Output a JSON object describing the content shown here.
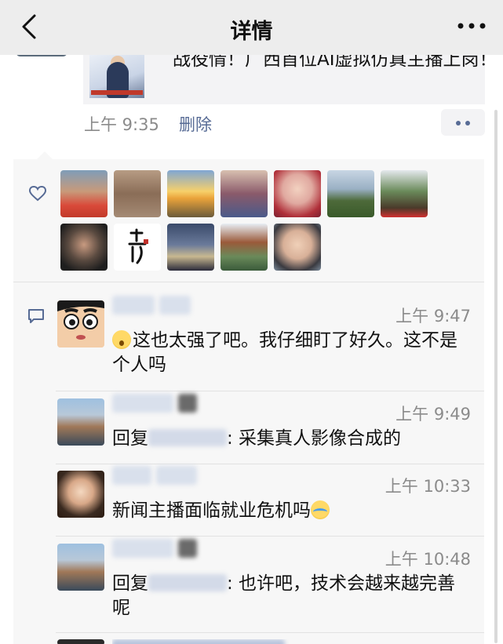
{
  "nav": {
    "title": "详情"
  },
  "post": {
    "share_text": "战役情！广西首位AI虚拟仿真主播上岗！",
    "time": "上午 9:35",
    "delete_label": "删除"
  },
  "likes": {
    "count": 12
  },
  "comments": [
    {
      "time": "上午 9:47",
      "text": "这也太强了吧。我仔细盯了好久。这不是个人吗",
      "emoji": "shocked-face-icon"
    },
    {
      "time": "上午 9:49",
      "reply_prefix": "回复",
      "text": ": 采集真人影像合成的"
    },
    {
      "time": "上午 10:33",
      "text": "新闻主播面临就业危机吗",
      "emoji": "crying-laughing-face-icon"
    },
    {
      "time": "上午 10:48",
      "reply_prefix": "回复",
      "text": ": 也许吧，技术会越来越完善呢"
    }
  ],
  "colors": {
    "link": "#576b95",
    "meta": "#8b8b8b",
    "panel": "#f7f7f7",
    "nav": "#ededed"
  }
}
